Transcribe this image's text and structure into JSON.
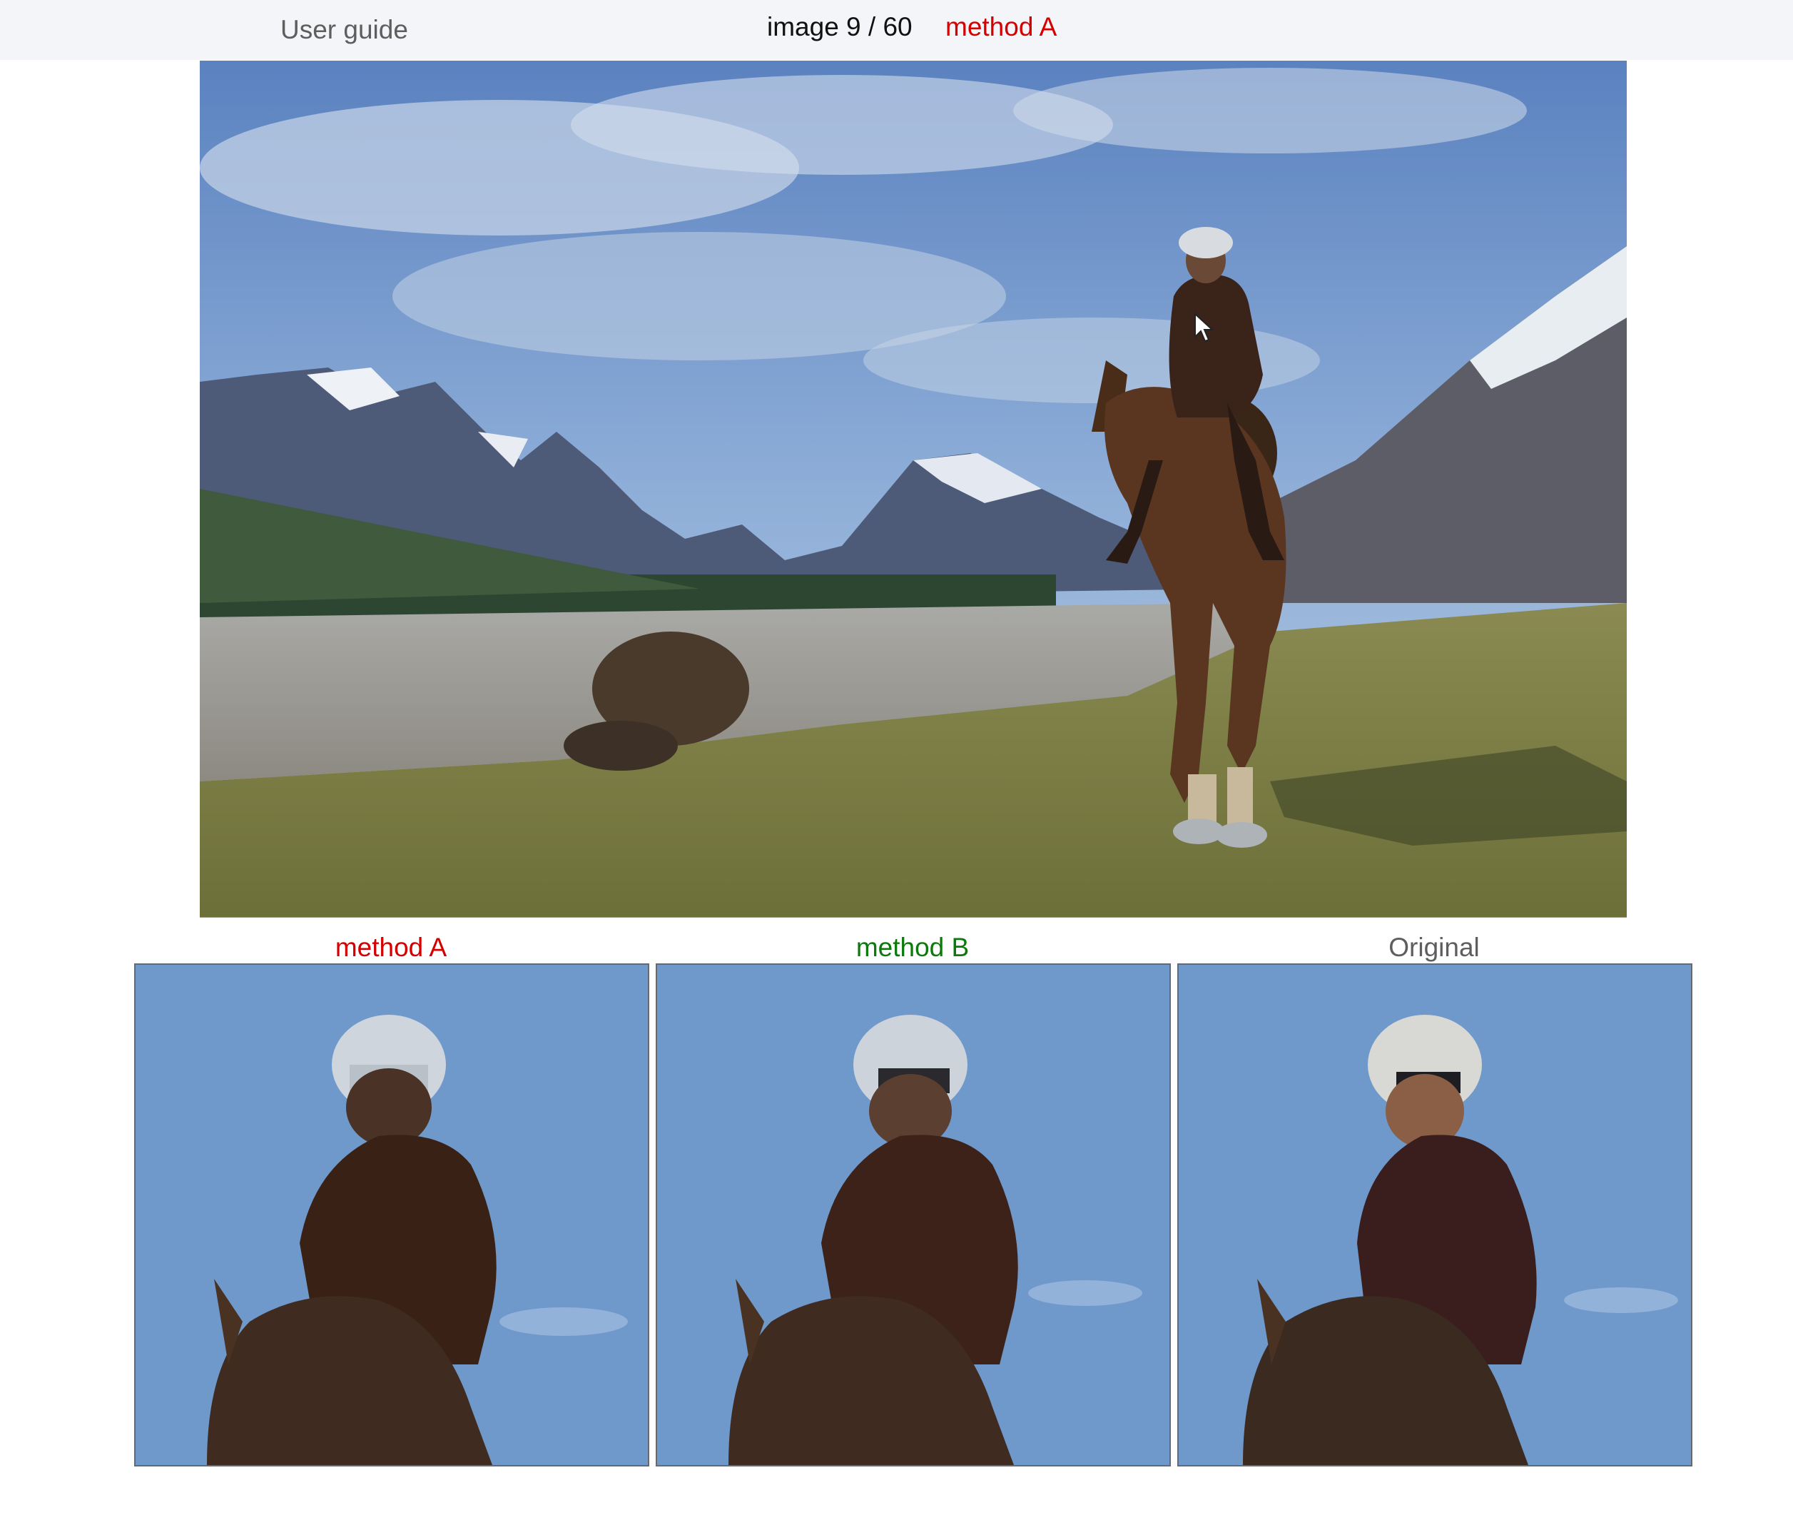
{
  "header": {
    "user_guide_label": "User guide",
    "counter": "image 9 / 60",
    "current_method": "method A",
    "current_method_color": "#d40000"
  },
  "main_image": {
    "description_icon": "landscape-photo",
    "cursor_icon": "mouse-pointer-icon"
  },
  "crops": [
    {
      "label": "method A",
      "color": "#d40000"
    },
    {
      "label": "method B",
      "color": "#0a7a0a"
    },
    {
      "label": "Original",
      "color": "#5e5e5e"
    }
  ],
  "colors": {
    "bar_background": "#f4f5f8",
    "method_a": "#d40000",
    "method_b": "#0a7a0a",
    "original": "#5e5e5e"
  }
}
